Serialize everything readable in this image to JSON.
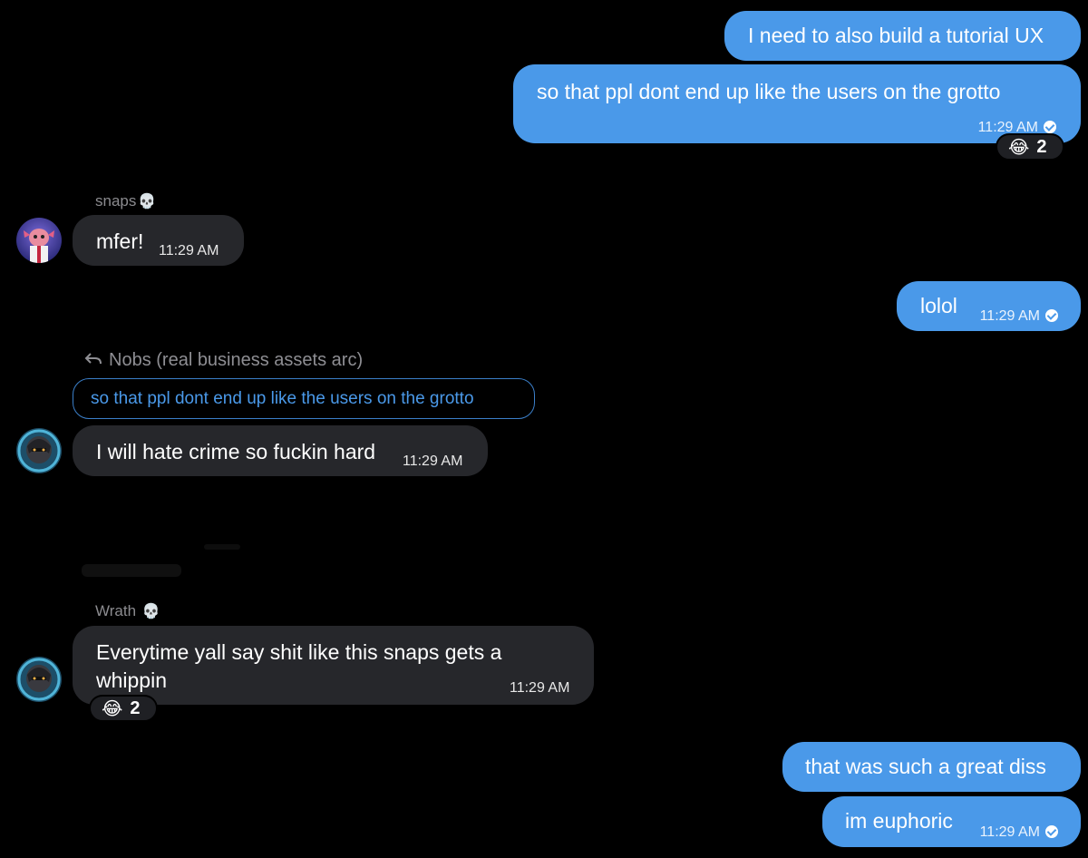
{
  "messages": {
    "m1": {
      "text": "I need to also build a tutorial UX"
    },
    "m2": {
      "text": "so that ppl dont end up like the users on the grotto",
      "time": "11:29 AM",
      "reaction_emoji": "😂",
      "reaction_count": "2"
    },
    "m3": {
      "sender": "snaps",
      "sender_badge": "💀",
      "text": "mfer!",
      "time": "11:29 AM"
    },
    "m4": {
      "text": "lolol",
      "time": "11:29 AM"
    },
    "m5": {
      "reply_to": "Nobs (real business assets arc)",
      "quote": "so that ppl dont end up like the users on the grotto",
      "text": "I will hate crime so fuckin hard",
      "time": "11:29 AM"
    },
    "m6": {
      "sender": "Wrath",
      "sender_badge": "💀",
      "text": "Everytime yall say shit like this snaps gets a whippin",
      "time": "11:29 AM",
      "reaction_emoji": "😂",
      "reaction_count": "2"
    },
    "m7": {
      "text": "that was such a great diss"
    },
    "m8": {
      "text": "im euphoric",
      "time": "11:29 AM"
    }
  },
  "icons": {
    "reply": "reply-arrow-icon",
    "read_receipt": "check-circle-icon",
    "sender_badge": "skull-icon"
  },
  "colors": {
    "outgoing_bubble": "#4a99e9",
    "incoming_bubble": "#26272b",
    "background": "#000000"
  }
}
